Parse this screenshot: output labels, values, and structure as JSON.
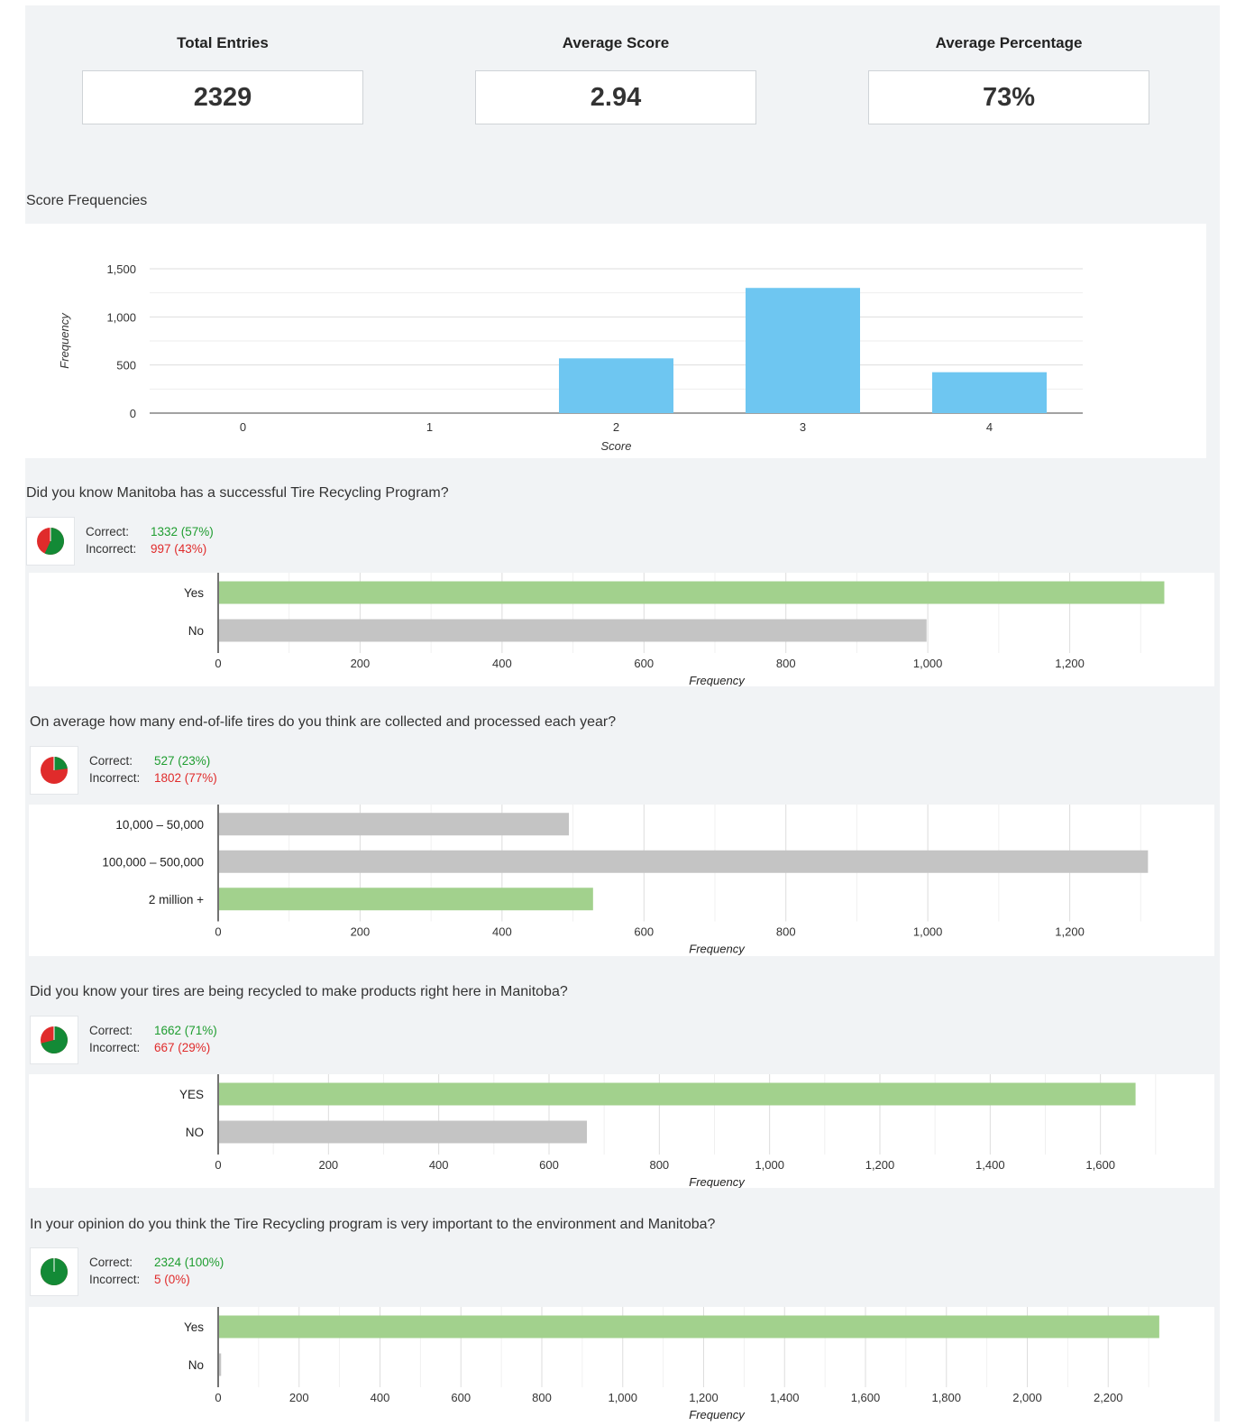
{
  "stats": [
    {
      "label": "Total Entries",
      "value": "2329"
    },
    {
      "label": "Average Score",
      "value": "2.94"
    },
    {
      "label": "Average Percentage",
      "value": "73%"
    }
  ],
  "colors": {
    "score_bar": "#6ec6f1",
    "correct_bar": "#a2d18d",
    "other_bar": "#c4c4c4",
    "pie_correct": "#138a36",
    "pie_incorrect": "#e02b2b",
    "correct_text": "#1f9d30",
    "incorrect_text": "#e02b2b"
  },
  "score_section": {
    "title": "Score Frequencies"
  },
  "labels": {
    "correct": "Correct:",
    "incorrect": "Incorrect:"
  },
  "questions": [
    {
      "title": "Did you know Manitoba has a successful Tire Recycling Program?",
      "correct": "1332 (57%)",
      "incorrect": "997 (43%)",
      "correct_fraction": 0.57
    },
    {
      "title": "On average how many end-of-life tires do you think are collected and processed each year?",
      "correct": "527 (23%)",
      "incorrect": "1802 (77%)",
      "correct_fraction": 0.23
    },
    {
      "title": "Did you know your tires are being recycled to make products right here in Manitoba?",
      "correct": "1662 (71%)",
      "incorrect": "667 (29%)",
      "correct_fraction": 0.71
    },
    {
      "title": "In your opinion do you think the Tire Recycling program is very important to the environment and Manitoba?",
      "correct": "2324 (100%)",
      "incorrect": "5 (0%)",
      "correct_fraction": 0.998
    }
  ],
  "chart_data": [
    {
      "type": "bar",
      "categories": [
        "0",
        "1",
        "2",
        "3",
        "4"
      ],
      "values": [
        0,
        0,
        569,
        1301,
        425
      ],
      "xlabel": "Score",
      "ylabel": "Frequency",
      "ylim": [
        0,
        1500
      ],
      "yticks": [
        0,
        500,
        1000,
        1500
      ],
      "ytick_labels": [
        "0",
        "500",
        "1,000",
        "1,500"
      ],
      "grid": true
    },
    {
      "type": "bar",
      "orientation": "horizontal",
      "categories": [
        "Yes",
        "No"
      ],
      "values": [
        1332,
        997
      ],
      "correct": [
        true,
        false
      ],
      "xlabel": "Frequency",
      "xlim": [
        0,
        1400
      ],
      "xticks": [
        0,
        200,
        400,
        600,
        800,
        1000,
        1200
      ],
      "xtick_labels": [
        "0",
        "200",
        "400",
        "600",
        "800",
        "1,000",
        "1,200"
      ],
      "grid": true
    },
    {
      "type": "bar",
      "orientation": "horizontal",
      "categories": [
        "10,000 – 50,000",
        "100,000 – 500,000",
        "2 million +"
      ],
      "values": [
        493,
        1309,
        527
      ],
      "correct": [
        false,
        false,
        true
      ],
      "xlabel": "Frequency",
      "xlim": [
        0,
        1400
      ],
      "xticks": [
        0,
        200,
        400,
        600,
        800,
        1000,
        1200
      ],
      "xtick_labels": [
        "0",
        "200",
        "400",
        "600",
        "800",
        "1,000",
        "1,200"
      ],
      "grid": true
    },
    {
      "type": "bar",
      "orientation": "horizontal",
      "categories": [
        "YES",
        "NO"
      ],
      "values": [
        1662,
        667
      ],
      "correct": [
        true,
        false
      ],
      "xlabel": "Frequency",
      "xlim": [
        0,
        1800
      ],
      "xticks": [
        0,
        200,
        400,
        600,
        800,
        1000,
        1200,
        1400,
        1600
      ],
      "xtick_labels": [
        "0",
        "200",
        "400",
        "600",
        "800",
        "1,000",
        "1,200",
        "1,400",
        "1,600"
      ],
      "grid": true
    },
    {
      "type": "bar",
      "orientation": "horizontal",
      "categories": [
        "Yes",
        "No"
      ],
      "values": [
        2324,
        5
      ],
      "correct": [
        true,
        false
      ],
      "xlabel": "Frequency",
      "xlim": [
        0,
        2400
      ],
      "xticks": [
        0,
        200,
        400,
        600,
        800,
        1000,
        1200,
        1400,
        1600,
        1800,
        2000,
        2200
      ],
      "xtick_labels": [
        "0",
        "200",
        "400",
        "600",
        "800",
        "1,000",
        "1,200",
        "1,400",
        "1,600",
        "1,800",
        "2,000",
        "2,200"
      ],
      "grid": true
    }
  ]
}
